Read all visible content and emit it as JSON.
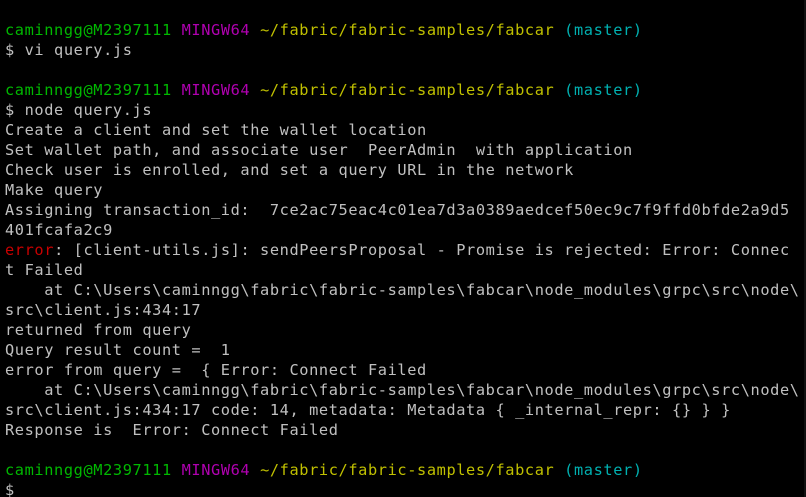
{
  "prompt1": {
    "user": "caminngg@M2397111",
    "env": "MINGW64",
    "path": "~/fabric/fabric-samples/fabcar",
    "branch": "(master)"
  },
  "cmd1": "$ vi query.js",
  "prompt2": {
    "user": "caminngg@M2397111",
    "env": "MINGW64",
    "path": "~/fabric/fabric-samples/fabcar",
    "branch": "(master)"
  },
  "cmd2": "$ node query.js",
  "output": [
    "Create a client and set the wallet location",
    "Set wallet path, and associate user  PeerAdmin  with application",
    "Check user is enrolled, and set a query URL in the network",
    "Make query",
    "Assigning transaction_id:  7ce2ac75eac4c01ea7d3a0389aedcef50ec9c7f9ffd0bfde2a9d5",
    "401fcafa2c9"
  ],
  "error_line": {
    "label": "error",
    "text": ": [client-utils.js]: sendPeersProposal - Promise is rejected: Error: Connec"
  },
  "output2": [
    "t Failed",
    "    at C:\\Users\\caminngg\\fabric\\fabric-samples\\fabcar\\node_modules\\grpc\\src\\node\\",
    "src\\client.js:434:17",
    "returned from query",
    "Query result count =  1",
    "error from query =  { Error: Connect Failed",
    "    at C:\\Users\\caminngg\\fabric\\fabric-samples\\fabcar\\node_modules\\grpc\\src\\node\\",
    "src\\client.js:434:17 code: 14, metadata: Metadata { _internal_repr: {} } }",
    "Response is  Error: Connect Failed"
  ],
  "prompt3": {
    "user": "caminngg@M2397111",
    "env": "MINGW64",
    "path": "~/fabric/fabric-samples/fabcar",
    "branch": "(master)"
  },
  "cmd3": "$",
  "colors": {
    "background": "#000000",
    "text": "#c0c0c0",
    "user": "#00b800",
    "env": "#b000b0",
    "path": "#c0c000",
    "branch": "#00b0b0",
    "error": "#c80000"
  }
}
